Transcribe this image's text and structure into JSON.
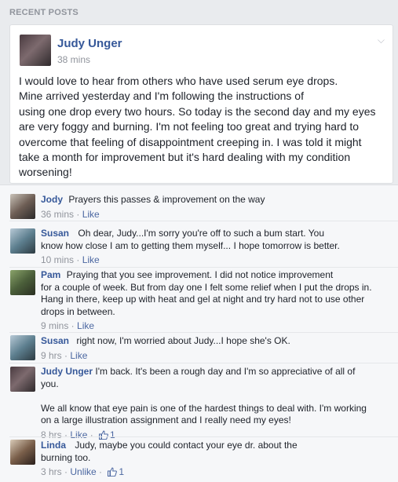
{
  "section": {
    "title": "RECENT POSTS"
  },
  "post": {
    "author": "Judy Unger",
    "time": "38 mins",
    "text": "I would love to hear from  others who have used serum  eye drops.\nMine arrived yesterday and I'm following the instructions of\nusing one drop every two hours. So today is the second day and my eyes\nare very foggy and burning. I'm not feeling too great and trying hard to\novercome that feeling of disappointment creeping in. I was told it might\ntake a month for improvement but it's hard dealing with my condition\nworsening!"
  },
  "comments": [
    {
      "name": "Jody",
      "text": "Prayers this passes & improvement on the way",
      "time": "36 mins",
      "action": "Like"
    },
    {
      "name": "Susan",
      "text": "Oh dear, Judy...I'm sorry you're off to such a bum start. You\nknow how close I am to getting them myself... I hope tomorrow is better.",
      "time": "10 mins",
      "action": "Like"
    },
    {
      "name": "Pam",
      "text": "Praying that you see improvement. I did not notice improvement\nfor a couple of week. But from day one I felt some relief when I put the drops in.\nHang in there, keep up with heat and gel at night and try hard not to use other\ndrops in between.",
      "time": "9 mins",
      "action": "Like"
    },
    {
      "name": "Susan",
      "text": "right now, I'm worried about Judy...I hope she's OK.",
      "time": "9 hrs",
      "action": "Like"
    },
    {
      "name": "Judy Unger",
      "text": "I'm back. It's been a rough day and I'm so appreciative of all of\nyou.\n\nWe all know that eye pain is one of the hardest things to deal with. I'm working\non a large illustration assignment and I really need my eyes!",
      "time": "8 hrs",
      "action": "Like",
      "likes": "1"
    },
    {
      "name": "Linda",
      "text": "Judy, maybe you could contact your eye dr. about the\nburning too.",
      "time": "3 hrs",
      "action": "Unlike",
      "likes": "1"
    }
  ],
  "colors": {
    "link": "#365899",
    "meta": "#90949c",
    "background": "#e9ebee"
  }
}
